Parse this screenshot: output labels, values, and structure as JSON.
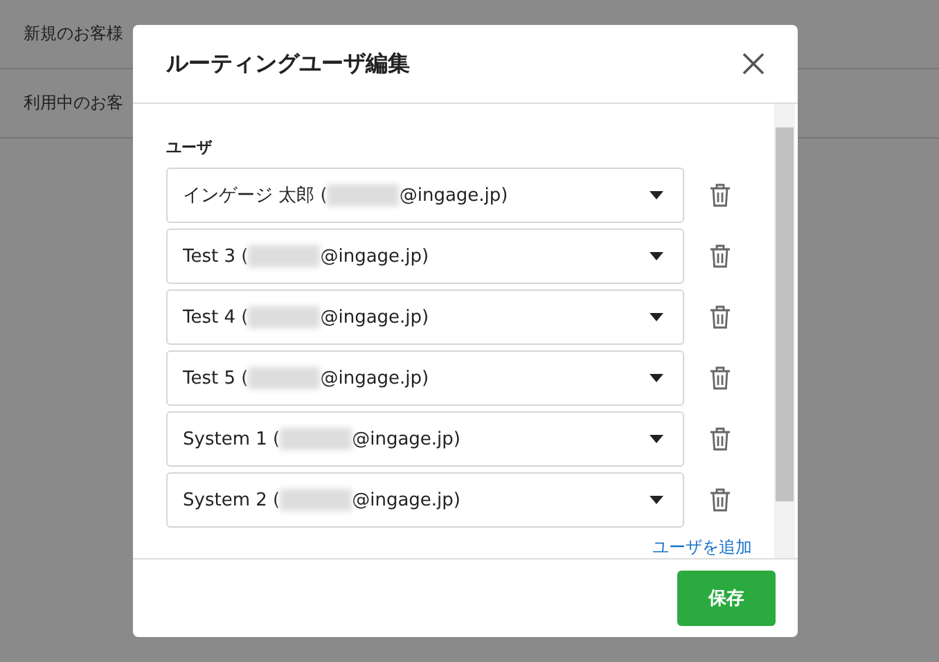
{
  "background_list": [
    {
      "label": "新規のお客様"
    },
    {
      "label": "利用中のお客"
    }
  ],
  "dialog": {
    "title": "ルーティングユーザ編集",
    "field_label": "ユーザ",
    "users": [
      {
        "name_before": "インゲージ 太郎 (",
        "name_after": "@ingage.jp)"
      },
      {
        "name_before": "Test 3 (",
        "name_after": "@ingage.jp)"
      },
      {
        "name_before": "Test 4 (",
        "name_after": "@ingage.jp)"
      },
      {
        "name_before": "Test 5 (",
        "name_after": "@ingage.jp)"
      },
      {
        "name_before": "System 1 (",
        "name_after": "@ingage.jp)"
      },
      {
        "name_before": "System 2 (",
        "name_after": "@ingage.jp)"
      }
    ],
    "add_link": "ユーザを追加",
    "save_button": "保存"
  }
}
